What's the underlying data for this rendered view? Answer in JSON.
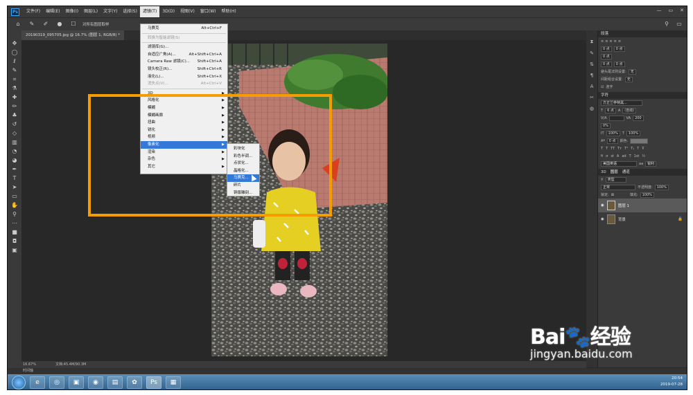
{
  "app": {
    "logo": "Ps"
  },
  "menubar": [
    "文件(F)",
    "编辑(E)",
    "图像(I)",
    "图层(L)",
    "文字(Y)",
    "选择(S)",
    "滤镜(T)",
    "3D(D)",
    "视图(V)",
    "窗口(W)",
    "帮助(H)"
  ],
  "active_menu_index": 6,
  "window_controls": [
    "—",
    "▭",
    "✕"
  ],
  "options_bar": {
    "checkbox_label": "对所有图层取样"
  },
  "document_tab": {
    "label": "20190319_095705.jpg @ 16.7% (图层 1, RGB/8) *"
  },
  "filter_menu": {
    "items": [
      {
        "label": "马赛克",
        "shortcut": "Alt+Ctrl+F"
      },
      {
        "sep": true
      },
      {
        "label": "转换为智能滤镜(S)",
        "disabled": true
      },
      {
        "sep": true
      },
      {
        "label": "滤镜库(G)..."
      },
      {
        "label": "自适应广角(A)...",
        "shortcut": "Alt+Shift+Ctrl+A"
      },
      {
        "label": "Camera Raw 滤镜(C)...",
        "shortcut": "Shift+Ctrl+A"
      },
      {
        "label": "镜头校正(R)...",
        "shortcut": "Shift+Ctrl+R"
      },
      {
        "label": "液化(L)...",
        "shortcut": "Shift+Ctrl+X"
      },
      {
        "label": "消失点(V)...",
        "shortcut": "Alt+Ctrl+V",
        "disabled": true
      },
      {
        "sep": true
      },
      {
        "label": "3D",
        "submenu": true
      },
      {
        "label": "风格化",
        "submenu": true
      },
      {
        "label": "模糊",
        "submenu": true
      },
      {
        "label": "模糊画廊",
        "submenu": true
      },
      {
        "label": "扭曲",
        "submenu": true
      },
      {
        "label": "锐化",
        "submenu": true
      },
      {
        "label": "视频",
        "submenu": true
      },
      {
        "label": "像素化",
        "submenu": true,
        "selected": true
      },
      {
        "label": "渲染",
        "submenu": true
      },
      {
        "label": "杂色",
        "submenu": true
      },
      {
        "label": "其它",
        "submenu": true
      }
    ]
  },
  "pixelate_submenu": {
    "items": [
      {
        "label": "彩块化"
      },
      {
        "label": "彩色半调..."
      },
      {
        "label": "点状化..."
      },
      {
        "label": "晶格化..."
      },
      {
        "label": "马赛克...",
        "selected": true
      },
      {
        "label": "碎片"
      },
      {
        "label": "铜版雕刻..."
      }
    ]
  },
  "paragraph_panel": {
    "title": "段落",
    "fields": [
      "0 点",
      "0 点",
      "0 点",
      "0 点",
      "0 点"
    ],
    "hyphen_label": "避头尾法则设置:",
    "hyphen_value": "无",
    "spacing_label": "间距组合设置:",
    "spacing_value": "无",
    "hyphenate_label": "连字"
  },
  "character_panel": {
    "title": "字符",
    "font_name": "方正兰亭特黑...",
    "font_size": "6 点",
    "leading": "(自动)",
    "tracking": "200",
    "scale": "0%",
    "vscale": "100%",
    "hscale": "100%",
    "baseline": "0 点",
    "color_label": "颜色:",
    "language": "美国英语",
    "aa": "锐利"
  },
  "layers_panel": {
    "tabs": [
      "3D",
      "图层",
      "通道"
    ],
    "filter_label": "类型",
    "blend_mode": "正常",
    "opacity_label": "不透明度:",
    "opacity_value": "100%",
    "lock_label": "锁定:",
    "fill_label": "填充:",
    "fill_value": "100%",
    "layers": [
      {
        "name": "图层 1",
        "selected": true
      },
      {
        "name": "背景",
        "locked": true
      }
    ]
  },
  "status_bar": {
    "zoom": "16.67%",
    "doc": "文档:45.4M/90.3M"
  },
  "timeline_label": "时间轴",
  "taskbar": {
    "apps": [
      "e",
      "◎",
      "▣",
      "◉",
      "▤",
      "✿",
      "Ps",
      "▦"
    ],
    "active_index": 6,
    "time": "20:54",
    "date": "2019-07-28"
  },
  "watermark": {
    "brand": "Bai🐾经验",
    "url": "jingyan.baidu.com"
  },
  "colors": {
    "highlight": "#f59c00",
    "menu_selected": "#3478d8",
    "ps_blue": "#31a8ff"
  }
}
